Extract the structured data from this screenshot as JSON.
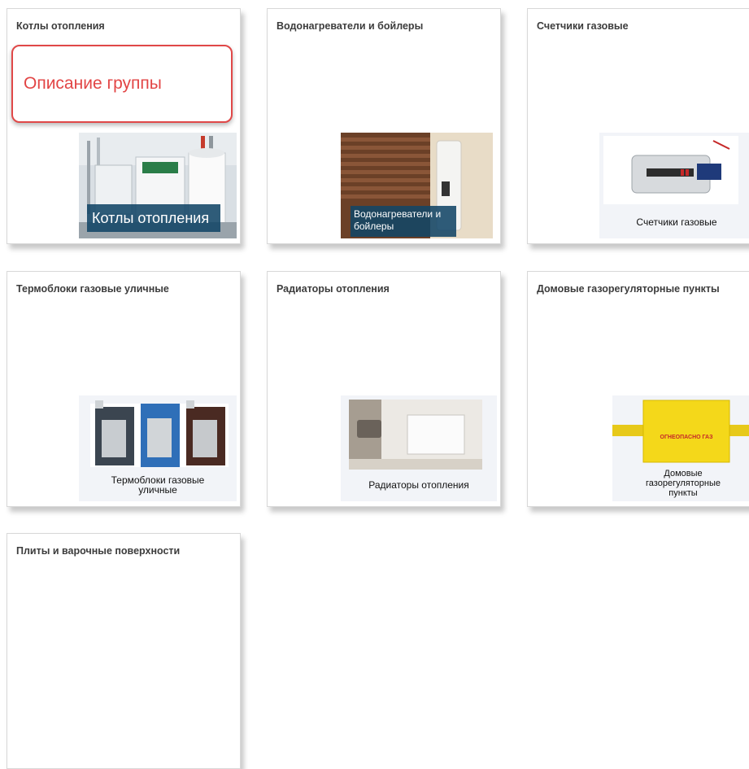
{
  "categories": [
    {
      "title": "Котлы отопления",
      "description": "Описание группы",
      "image_label": "Котлы отопления"
    },
    {
      "title": "Водонагреватели и бойлеры",
      "image_label": "Водонагреватели и бойлеры"
    },
    {
      "title": "Счетчики газовые",
      "image_label": "Счетчики газовые"
    },
    {
      "title": "Термоблоки газовые уличные",
      "image_label": "Термоблоки газовые уличные"
    },
    {
      "title": "Радиаторы отопления",
      "image_label": "Радиаторы отопления"
    },
    {
      "title": "Домовые газорегуляторные пункты",
      "image_label": "Домовые газорегуляторные пункты",
      "box_text": "ОГНЕОПАСНО ГАЗ"
    },
    {
      "title": "Плиты и варочные поверхности"
    }
  ],
  "colors": {
    "description_border": "#e04848",
    "overlay": "#124666",
    "card_border": "#d8d8d8"
  }
}
